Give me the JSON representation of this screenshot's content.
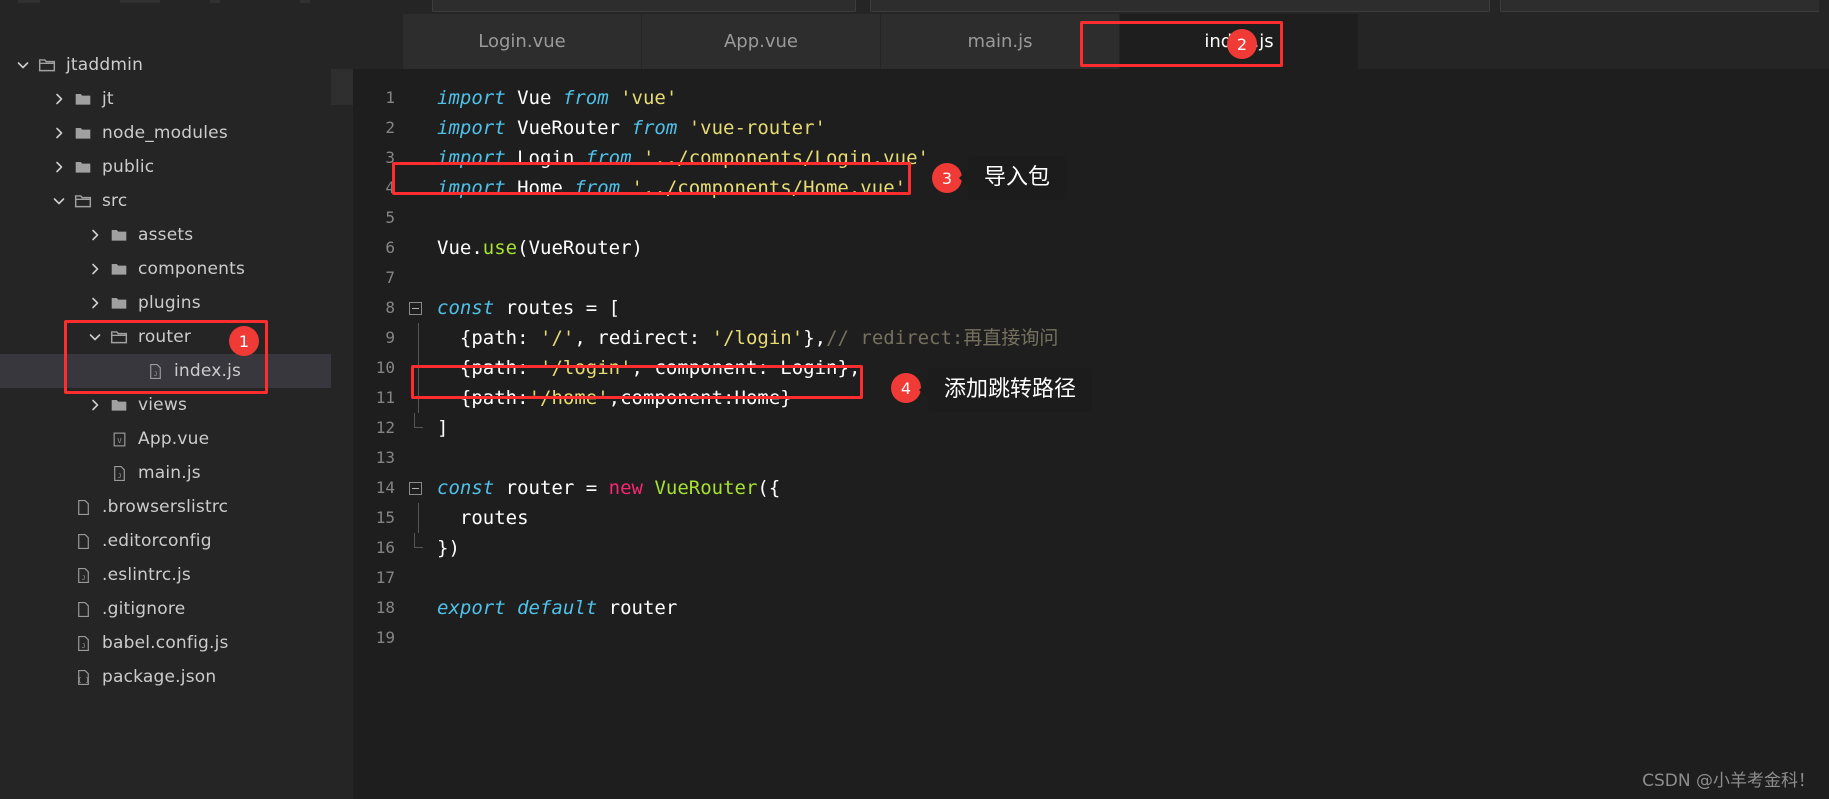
{
  "window": {
    "background": "#1e1e1e",
    "sidebar_background": "#252526",
    "accent_red": "#f03a36",
    "highlight_border": "#ff2d2d"
  },
  "explorer": {
    "items": [
      {
        "label": "jtaddmin",
        "depth": 0,
        "icon": "folder-open-root-icon",
        "twisty": "chevron-down",
        "selected": false
      },
      {
        "label": "jt",
        "depth": 1,
        "icon": "folder-icon",
        "twisty": "chevron-right",
        "selected": false
      },
      {
        "label": "node_modules",
        "depth": 1,
        "icon": "folder-icon",
        "twisty": "chevron-right",
        "selected": false
      },
      {
        "label": "public",
        "depth": 1,
        "icon": "folder-icon",
        "twisty": "chevron-right",
        "selected": false
      },
      {
        "label": "src",
        "depth": 1,
        "icon": "folder-open-icon",
        "twisty": "chevron-down",
        "selected": false
      },
      {
        "label": "assets",
        "depth": 2,
        "icon": "folder-icon",
        "twisty": "chevron-right",
        "selected": false
      },
      {
        "label": "components",
        "depth": 2,
        "icon": "folder-icon",
        "twisty": "chevron-right",
        "selected": false
      },
      {
        "label": "plugins",
        "depth": 2,
        "icon": "folder-icon",
        "twisty": "chevron-right",
        "selected": false
      },
      {
        "label": "router",
        "depth": 2,
        "icon": "folder-open-icon",
        "twisty": "chevron-down",
        "selected": false
      },
      {
        "label": "index.js",
        "depth": 3,
        "icon": "js-file-icon",
        "twisty": "none",
        "selected": true
      },
      {
        "label": "views",
        "depth": 2,
        "icon": "folder-icon",
        "twisty": "chevron-right",
        "selected": false
      },
      {
        "label": "App.vue",
        "depth": 2,
        "icon": "vue-file-icon",
        "twisty": "none",
        "selected": false
      },
      {
        "label": "main.js",
        "depth": 2,
        "icon": "js-file-icon",
        "twisty": "none",
        "selected": false
      },
      {
        "label": ".browserslistrc",
        "depth": 1,
        "icon": "plain-file-icon",
        "twisty": "none",
        "selected": false
      },
      {
        "label": ".editorconfig",
        "depth": 1,
        "icon": "plain-file-icon",
        "twisty": "none",
        "selected": false
      },
      {
        "label": ".eslintrc.js",
        "depth": 1,
        "icon": "js-file-icon",
        "twisty": "none",
        "selected": false
      },
      {
        "label": ".gitignore",
        "depth": 1,
        "icon": "plain-file-icon",
        "twisty": "none",
        "selected": false
      },
      {
        "label": "babel.config.js",
        "depth": 1,
        "icon": "js-file-icon",
        "twisty": "none",
        "selected": false
      },
      {
        "label": "package.json",
        "depth": 1,
        "icon": "json-file-icon",
        "twisty": "none",
        "selected": false
      }
    ]
  },
  "tabs": [
    {
      "label": "Login.vue",
      "active": false
    },
    {
      "label": "App.vue",
      "active": false
    },
    {
      "label": "main.js",
      "active": false
    },
    {
      "label": "index.js",
      "active": true
    }
  ],
  "code": {
    "language": "javascript",
    "lines": [
      {
        "n": "1",
        "fold": "none",
        "text": "import Vue from 'vue'"
      },
      {
        "n": "2",
        "fold": "none",
        "text": "import VueRouter from 'vue-router'"
      },
      {
        "n": "3",
        "fold": "none",
        "text": "import Login from '../components/Login.vue'"
      },
      {
        "n": "4",
        "fold": "none",
        "text": "import Home from '../components/Home.vue'"
      },
      {
        "n": "5",
        "fold": "none",
        "text": ""
      },
      {
        "n": "6",
        "fold": "none",
        "text": "Vue.use(VueRouter)"
      },
      {
        "n": "7",
        "fold": "none",
        "text": ""
      },
      {
        "n": "8",
        "fold": "open",
        "text": "const routes = ["
      },
      {
        "n": "9",
        "fold": "bar",
        "text": "  {path: '/', redirect: '/login'},// redirect:再直接询问"
      },
      {
        "n": "10",
        "fold": "bar",
        "text": "  {path: '/login', component: Login},"
      },
      {
        "n": "11",
        "fold": "bar",
        "text": "  {path:'/home',component:Home}"
      },
      {
        "n": "12",
        "fold": "end",
        "text": "]"
      },
      {
        "n": "13",
        "fold": "none",
        "text": ""
      },
      {
        "n": "14",
        "fold": "open",
        "text": "const router = new VueRouter({"
      },
      {
        "n": "15",
        "fold": "bar",
        "text": "  routes"
      },
      {
        "n": "16",
        "fold": "end",
        "text": "})"
      },
      {
        "n": "17",
        "fold": "none",
        "text": ""
      },
      {
        "n": "18",
        "fold": "none",
        "text": "export default router"
      },
      {
        "n": "19",
        "fold": "none",
        "text": ""
      }
    ]
  },
  "annotations": {
    "badges": [
      {
        "number": "1",
        "target": "router-folder-in-explorer"
      },
      {
        "number": "2",
        "target": "index-js-tab"
      },
      {
        "number": "3",
        "target": "import-home-line"
      },
      {
        "number": "4",
        "target": "home-route-line"
      }
    ],
    "callouts": [
      {
        "number": "3",
        "text": "导入包"
      },
      {
        "number": "4",
        "text": "添加跳转路径"
      }
    ]
  },
  "watermark": {
    "text": "CSDN @小羊考金科！"
  }
}
